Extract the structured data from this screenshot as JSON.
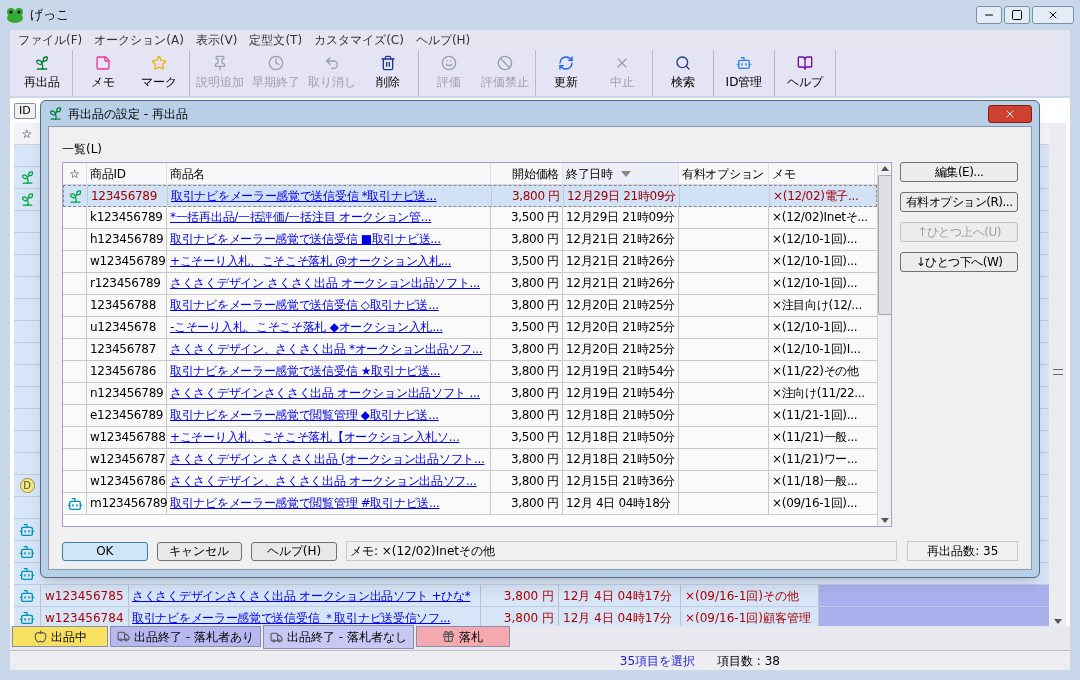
{
  "window": {
    "title": "げっこ"
  },
  "menu": [
    "ファイル(F)",
    "オークション(A)",
    "表示(V)",
    "定型文(T)",
    "カスタマイズ(C)",
    "ヘルプ(H)"
  ],
  "toolbar": [
    [
      {
        "label": "再出品",
        "disabled": false
      }
    ],
    [
      {
        "label": "メモ",
        "disabled": false
      },
      {
        "label": "マーク",
        "disabled": false
      }
    ],
    [
      {
        "label": "説明追加",
        "disabled": true
      },
      {
        "label": "早期終了",
        "disabled": true
      },
      {
        "label": "取り消し",
        "disabled": true
      },
      {
        "label": "削除",
        "disabled": false
      }
    ],
    [
      {
        "label": "評価",
        "disabled": true
      },
      {
        "label": "評価禁止",
        "disabled": true
      }
    ],
    [
      {
        "label": "更新",
        "disabled": false
      },
      {
        "label": "中止",
        "disabled": true
      }
    ],
    [
      {
        "label": "検索",
        "disabled": false
      }
    ],
    [
      {
        "label": "ID管理",
        "disabled": false
      }
    ],
    [
      {
        "label": "ヘルプ",
        "disabled": false
      }
    ]
  ],
  "main_list": {
    "filter_button": "ID",
    "star_header": "☆",
    "rows": [
      {
        "kind": "none"
      },
      {
        "kind": "sprout"
      },
      {
        "kind": "sprout"
      },
      {
        "kind": "none"
      },
      {
        "kind": "none"
      },
      {
        "kind": "none"
      },
      {
        "kind": "none"
      },
      {
        "kind": "none"
      },
      {
        "kind": "none"
      },
      {
        "kind": "none"
      },
      {
        "kind": "none"
      },
      {
        "kind": "none"
      },
      {
        "kind": "none"
      },
      {
        "kind": "none"
      },
      {
        "kind": "none"
      },
      {
        "kind": "badge",
        "badge": "D"
      },
      {
        "kind": "none"
      },
      {
        "kind": "robot"
      },
      {
        "kind": "robot"
      },
      {
        "kind": "robot"
      },
      {
        "kind": "robot",
        "id": "w123456785",
        "name": "さくさくデザインさくさく出品 オークション出品ソフト +ひな*",
        "price": "3,800 円",
        "end": "12月 4日 04時17分",
        "memo": "×(09/16-1回)その他"
      },
      {
        "kind": "robot",
        "id": "w123456784",
        "name": "取引ナビをメーラー感覚で送信受信 ＊取引ナビ送受信ソフ...",
        "price": "3,800 円",
        "end": "12月 4日 04時17分",
        "memo": "×(09/16-1回)顧客管理"
      }
    ]
  },
  "dialog": {
    "title": "再出品の設定 - 再出品",
    "list_label": "一覧(L)",
    "columns": [
      {
        "label": "☆",
        "sorted": false
      },
      {
        "label": "商品ID",
        "sorted": false
      },
      {
        "label": "商品名",
        "sorted": false
      },
      {
        "label": "開始価格",
        "sorted": false
      },
      {
        "label": "終了日時",
        "sorted": true
      },
      {
        "label": "有料オプション",
        "sorted": false
      },
      {
        "label": "メモ",
        "sorted": false
      }
    ],
    "rows": [
      {
        "kind": "sprout",
        "selected": true,
        "id": "123456789",
        "name": "取引ナビをメーラー感覚で送信受信 *取引ナビ送...",
        "price": "3,800 円",
        "end": "12月29日 21時09分",
        "memo": "×(12/02)電子..."
      },
      {
        "kind": "none",
        "selected": false,
        "id": "k123456789",
        "name": "*一括再出品/一括評価/一括注目 オークション管...",
        "price": "3,500 円",
        "end": "12月29日 21時09分",
        "memo": "×(12/02)Inetそ..."
      },
      {
        "kind": "none",
        "selected": false,
        "id": "h123456789",
        "name": "取引ナビをメーラー感覚で送信受信 ■取引ナビ送...",
        "price": "3,800 円",
        "end": "12月21日 21時26分",
        "memo": "×(12/10-1回)..."
      },
      {
        "kind": "none",
        "selected": false,
        "id": "w123456789",
        "name": "+こそーり入札、こそこそ落札 @オークション入札...",
        "price": "3,500 円",
        "end": "12月21日 21時26分",
        "memo": "×(12/10-1回)..."
      },
      {
        "kind": "none",
        "selected": false,
        "id": "r123456789",
        "name": "さくさくデザイン さくさく出品 オークション出品ソフト...",
        "price": "3,800 円",
        "end": "12月21日 21時26分",
        "memo": "×(12/10-1回)..."
      },
      {
        "kind": "none",
        "selected": false,
        "id": "123456788",
        "name": "取引ナビをメーラー感覚で送信受信 ◇取引ナビ送...",
        "price": "3,800 円",
        "end": "12月20日 21時25分",
        "memo": "×注目向け(12/..."
      },
      {
        "kind": "none",
        "selected": false,
        "id": "u12345678",
        "name": "-こそーり入札、こそこそ落札 ◆オークション入札...",
        "price": "3,500 円",
        "end": "12月20日 21時25分",
        "memo": "×(12/10-1回)..."
      },
      {
        "kind": "none",
        "selected": false,
        "id": "123456787",
        "name": "さくさくデザイン、さくさく出品 *オークション出品ソフ...",
        "price": "3,800 円",
        "end": "12月20日 21時25分",
        "memo": "×(12/10-1回)I..."
      },
      {
        "kind": "none",
        "selected": false,
        "id": "123456786",
        "name": "取引ナビをメーラー感覚で送信受信 ★取引ナビ送...",
        "price": "3,800 円",
        "end": "12月19日 21時54分",
        "memo": "×(11/22)その他"
      },
      {
        "kind": "none",
        "selected": false,
        "id": "n123456789",
        "name": "さくさくデザインさくさく出品 オークション出品ソフト ...",
        "price": "3,800 円",
        "end": "12月19日 21時54分",
        "memo": "×注向け(11/22..."
      },
      {
        "kind": "none",
        "selected": false,
        "id": "e123456789",
        "name": "取引ナビをメーラー感覚で閲覧管理 ◆取引ナビ送...",
        "price": "3,800 円",
        "end": "12月18日 21時50分",
        "memo": "×(11/21-1回)..."
      },
      {
        "kind": "none",
        "selected": false,
        "id": "w123456788",
        "name": "+こそーり入札、こそこそ落札【オークション入札ソ...",
        "price": "3,500 円",
        "end": "12月18日 21時50分",
        "memo": "×(11/21)一般..."
      },
      {
        "kind": "none",
        "selected": false,
        "id": "w123456787",
        "name": "さくさくデザイン さくさく出品 (オークション出品ソフト...",
        "price": "3,800 円",
        "end": "12月18日 21時50分",
        "memo": "×(11/21)ワー..."
      },
      {
        "kind": "none",
        "selected": false,
        "id": "w123456786",
        "name": "さくさくデザイン、さくさく出品 オークション出品ソフ...",
        "price": "3,800 円",
        "end": "12月15日 21時36分",
        "memo": "×(11/18)一般..."
      },
      {
        "kind": "robot",
        "selected": false,
        "id": "m123456789",
        "name": "取引ナビをメーラー感覚で閲覧管理 #取引ナビ送...",
        "price": "3,800 円",
        "end": "12月 4日 04時18分",
        "memo": "×(09/16-1回)..."
      }
    ],
    "side_buttons": [
      {
        "label": "編集(E)...",
        "disabled": false
      },
      {
        "label": "有料オプション(R)...",
        "disabled": false
      },
      {
        "label": "↑ひとつ上へ(U)",
        "disabled": true
      },
      {
        "label": "↓ひとつ下へ(W)",
        "disabled": false
      }
    ],
    "buttons": [
      {
        "label": "OK",
        "default": true
      },
      {
        "label": "キャンセル",
        "default": false
      },
      {
        "label": "ヘルプ(H)",
        "default": false
      }
    ],
    "memo_field": {
      "value": "メモ: ×(12/02)Inetその他"
    },
    "count": "再出品数: 35"
  },
  "tabs": [
    {
      "label": "出品中",
      "color": "#f8e060",
      "selected": false
    },
    {
      "label": "出品終了 - 落札者あり",
      "color": "#b8b8f0",
      "selected": false
    },
    {
      "label": "出品終了 - 落札者なし",
      "color": "#c8c8f4",
      "selected": true
    },
    {
      "label": "落札",
      "color": "#f4a8b0",
      "selected": false
    }
  ],
  "status_bar": {
    "selection": "35項目を選択",
    "count": "項目数 : 38"
  }
}
